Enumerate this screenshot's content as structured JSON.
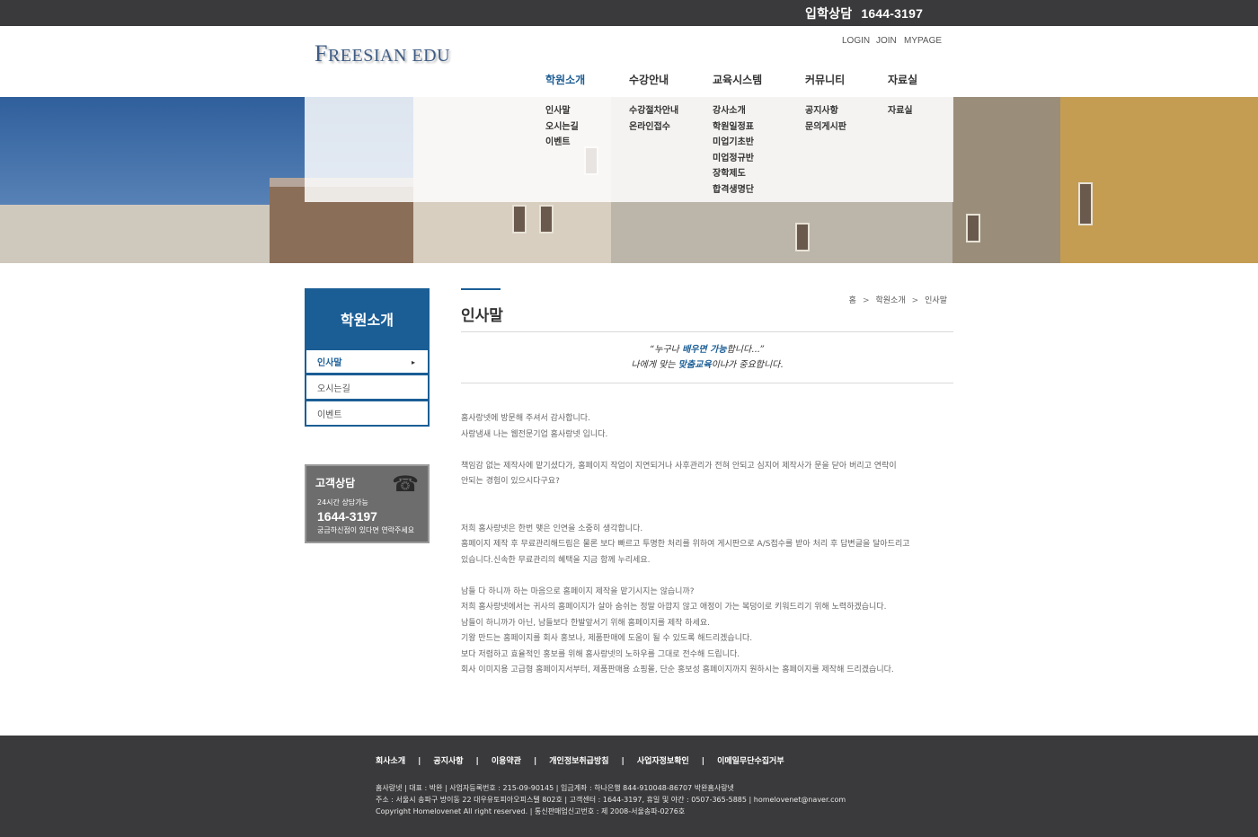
{
  "topbar": {
    "label": "입학상담",
    "phone": "1644-3197"
  },
  "header": {
    "logo": {
      "cap": "F",
      "rest": "REESIAN EDU"
    },
    "util": [
      "LOGIN",
      "JOIN",
      "MYPAGE"
    ]
  },
  "gnb": [
    {
      "label": "학원소개",
      "active": true,
      "items": [
        "인사말",
        "오시는길",
        "이벤트"
      ]
    },
    {
      "label": "수강안내",
      "items": [
        "수강절차안내",
        "온라인접수"
      ]
    },
    {
      "label": "교육시스템",
      "items": [
        "강사소개",
        "학원일정표",
        "미업기초반",
        "미업정규반",
        "장학제도",
        "합격생명단"
      ]
    },
    {
      "label": "커뮤니티",
      "items": [
        "공지사항",
        "문의게시판"
      ]
    },
    {
      "label": "자료실",
      "items": [
        "자료실"
      ]
    }
  ],
  "lnb": {
    "title": "학원소개",
    "items": [
      {
        "label": "인사말",
        "active": true
      },
      {
        "label": "오시는길"
      },
      {
        "label": "이벤트"
      }
    ],
    "arrow": "▸"
  },
  "customer": {
    "title": "고객상담",
    "sub": "24시간 상담가능",
    "phone": "1644-3197",
    "desc": "궁금하신점이 있다면 연락주세요",
    "icon": "telephone-icon"
  },
  "content": {
    "title": "인사말",
    "breadcrumb": [
      "홈",
      "학원소개",
      "인사말"
    ],
    "slogan": {
      "line1_a": "“누구나 ",
      "line1_b": "배우면 가능",
      "line1_c": "합니다...”",
      "line2_a": "나에게 맞는 ",
      "line2_b": "맞춤교육",
      "line2_c": "이냐가 중요합니다."
    },
    "paragraphs": [
      [
        "홈사랑넷에 방문해 주셔서 감사합니다.",
        "사랑냄새 나는 웹전문기업 홈사랑넷 입니다."
      ],
      [
        "책임감 없는 제작사에 맡기셨다가, 홈페이지 작업이 지연되거나 사후관리가 전혀 안되고 심지어 제작사가 문을 닫아 버리고 연락이",
        "안되는 경험이 있으시다구요?"
      ],
      [
        "저희 홈사랑넷은 한번 맺은 인연을 소중히 생각합니다.",
        "홈페이지 제작 후 무료관리해드림은 물론 보다 빠르고 투명한 처리를 위하여 게시판으로 A/S접수를 받아 처리 후 답변글을 달아드리고",
        "있습니다.신속한 무료관리의 혜택을 지금 함께 누리세요."
      ],
      [
        "남들 다 하니까 하는 마음으로 홈페이지 제작을 맡기시지는 않습니까?",
        "저희 홈사랑넷에서는 귀사의 홈페이지가 살아 숨쉬는 정말 아깝지 않고 애정이 가는 복덩이로 키워드리기 위해 노력하겠습니다.",
        "남들이 하니까가 아닌, 남들보다 한발앞서기 위해 홈페이지를 제작 하세요.",
        "기왕 만드는 홈페이지를 회사 홍보나, 제품판매에 도움이 될 수 있도록 해드리겠습니다.",
        "보다 저렴하고 효율적인 홍보를 위해 홈사랑넷의 노하우를 그대로 전수해 드립니다.",
        "회사 이미지용 고급형 홈페이지서부터, 제품판매용 쇼핑몰, 단순 홍보성 홈페이지까지 원하시는 홈페이지를 제작해 드리겠습니다."
      ]
    ]
  },
  "footer": {
    "links": [
      "회사소개",
      "공지사항",
      "이용약관",
      "개인정보취급방침",
      "사업자정보확인",
      "이메일무단수집거부"
    ],
    "info": [
      "홈사랑넷  |  대표 : 박완  |  사업자등록번호 : 215-09-90145  |  입금계좌 : 하나은행 844-910048-86707 박완홈사랑넷",
      " 주소 : 서울시 송파구 방이동 22 대우유토피아오피스텔 802호  |  고객센터 : 1644-3197, 휴일 및 야간 : 0507-365-5885  |  homelovenet@naver.com",
      " Copyright Homelovenet All right reserved.   |  통신판매업신고번호 : 제 2008-서울송파-0276호"
    ]
  }
}
